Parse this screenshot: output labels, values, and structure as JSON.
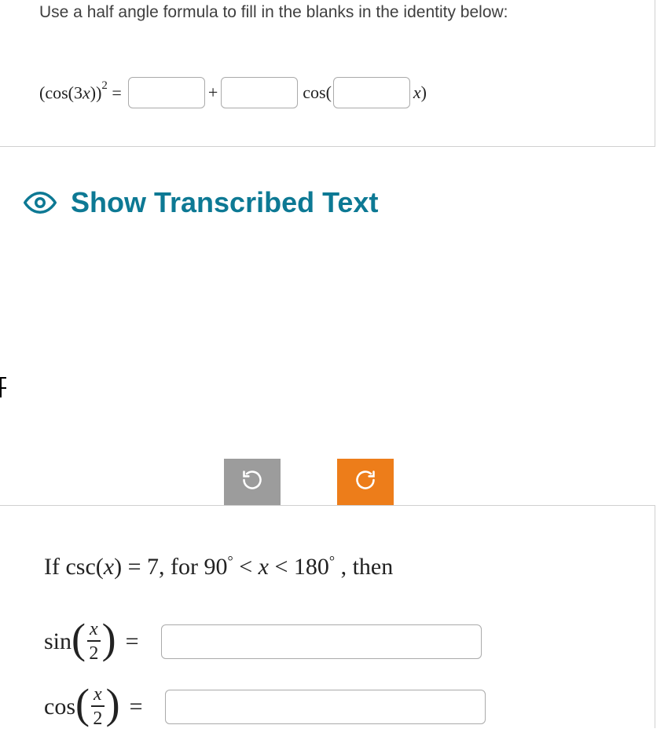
{
  "question1": {
    "instruction": "Use a half angle formula to fill in the blanks in the identity below:",
    "lhs_prefix": "(cos(3",
    "lhs_var": "x",
    "lhs_suffix": "))",
    "exp": "2",
    "equals": " = ",
    "plus": "+",
    "cos_open": "cos(",
    "var_close_paren": "x",
    "close": ")"
  },
  "toggle": {
    "label": "Show Transcribed Text"
  },
  "question2": {
    "line1_a": "If csc(",
    "line1_var": "x",
    "line1_b": ") = 7,  for 90",
    "deg1": "°",
    "line1_c": "  <  ",
    "line1_var2": "x",
    "line1_d": "  <  180",
    "deg2": "°",
    "line1_e": " ,  then",
    "sin_label": "sin",
    "cos_label": "cos",
    "frac_num": "x",
    "frac_den": "2",
    "equals": "="
  }
}
